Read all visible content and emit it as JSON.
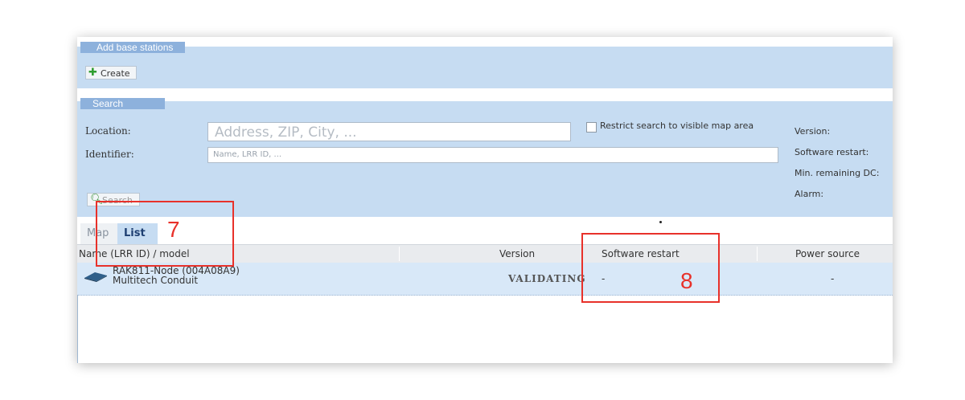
{
  "add_section": {
    "legend": "Add base stations",
    "create_label": "Create"
  },
  "search_section": {
    "legend": "Search",
    "location_label": "Location:",
    "location_placeholder": "Address, ZIP, City, ...",
    "restrict_label": "Restrict search to visible map area",
    "identifier_label": "Identifier:",
    "identifier_placeholder": "Name, LRR ID, ...",
    "search_label": "Search",
    "filters": [
      "Version:",
      "Software restart:",
      "Min. remaining DC:",
      "Alarm:"
    ]
  },
  "tabs": {
    "map": "Map",
    "list": "List"
  },
  "table": {
    "headers": [
      "Name (LRR ID) / model",
      "Version",
      "Software restart",
      "Power source"
    ],
    "rows": [
      {
        "name": "RAK811-Node (004A08A9)",
        "model": "Multitech Conduit",
        "version": "VALIDATING",
        "software_restart": "-",
        "power_source": "-"
      }
    ]
  },
  "annotations": {
    "tab_marker": "7",
    "column_marker": "8"
  },
  "colors": {
    "panel": "#c6dcf2",
    "legend": "#8db1dc",
    "annotation": "#e8312a"
  }
}
